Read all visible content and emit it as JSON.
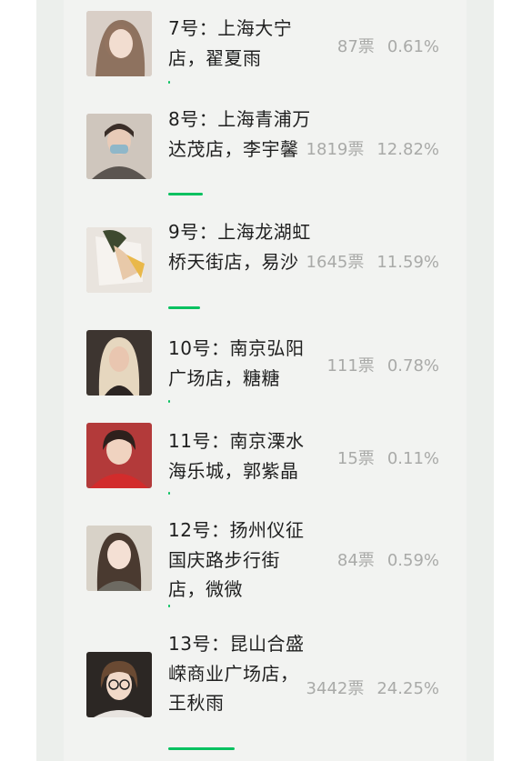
{
  "poll": {
    "options": [
      {
        "name": "7号：上海大宁店，翟夏雨",
        "votes": "87票",
        "percent": "0.61%",
        "share": 0.0061
      },
      {
        "name": "8号：上海青浦万达茂店，李宇馨",
        "votes": "1819票",
        "percent": "12.82%",
        "share": 0.1282
      },
      {
        "name": "9号：上海龙湖虹桥天街店，易沙",
        "votes": "1645票",
        "percent": "11.59%",
        "share": 0.1159
      },
      {
        "name": "10号：南京弘阳广场店，糖糖",
        "votes": "111票",
        "percent": "0.78%",
        "share": 0.0078
      },
      {
        "name": "11号：南京溧水海乐城，郭紫晶",
        "votes": "15票",
        "percent": "0.11%",
        "share": 0.0011
      },
      {
        "name": "12号：扬州仪征国庆路步行街店，微微",
        "votes": "84票",
        "percent": "0.59%",
        "share": 0.0059
      },
      {
        "name": "13号：昆山合盛嵘商业广场店，王秋雨",
        "votes": "3442票",
        "percent": "24.25%",
        "share": 0.2425
      }
    ],
    "colors": {
      "bar": "#08c160",
      "stats_text": "#a9aaa8",
      "name_text": "#1f1f1f"
    }
  }
}
